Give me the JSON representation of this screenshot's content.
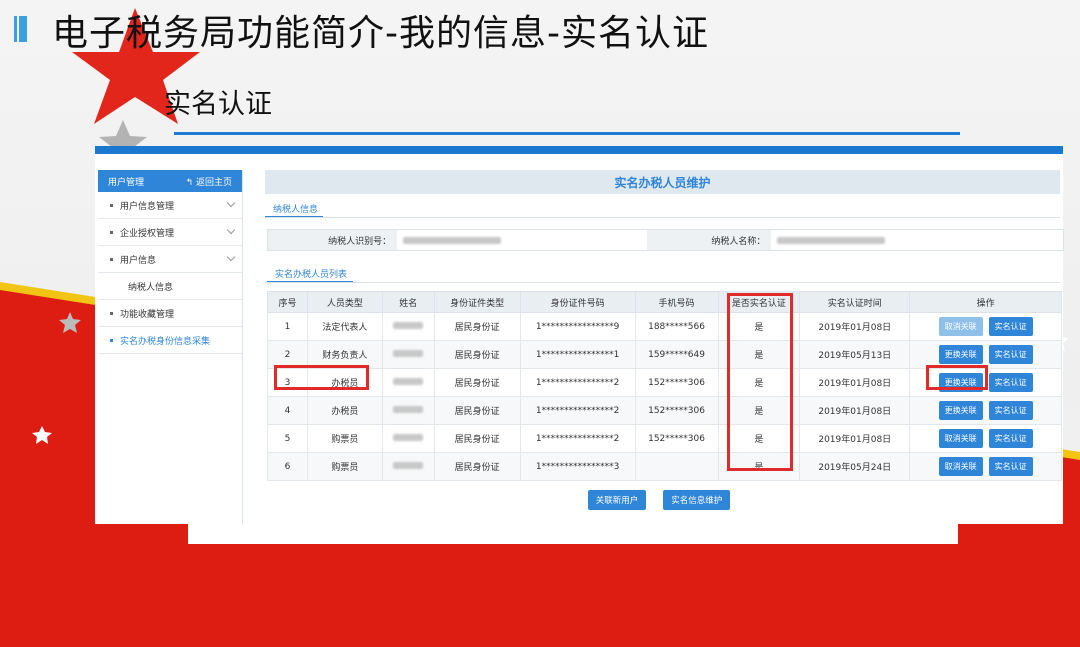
{
  "slide": {
    "title": "电子税务局功能简介-我的信息-实名认证",
    "subtitle": "实名认证"
  },
  "colors": {
    "accent": "#2f86d8",
    "highlight": "#e12a2a",
    "banner_red": "#dd1c12"
  },
  "sidebar": {
    "header": "用户管理",
    "back": "返回主页",
    "items": [
      {
        "label": "用户信息管理"
      },
      {
        "label": "企业授权管理"
      },
      {
        "label": "用户信息"
      },
      {
        "label": "纳税人信息"
      },
      {
        "label": "功能收藏管理"
      },
      {
        "label": "实名办税身份信息采集"
      }
    ]
  },
  "main": {
    "header": "实名办税人员维护",
    "tab1": "纳税人信息",
    "tab2": "实名办税人员列表",
    "taxpayer_id_label": "纳税人识别号：",
    "taxpayer_name_label": "纳税人名称："
  },
  "table": {
    "columns": [
      "序号",
      "人员类型",
      "姓名",
      "身份证件类型",
      "身份证件号码",
      "手机号码",
      "是否实名认证",
      "实名认证时间",
      "操作"
    ],
    "rows": [
      {
        "no": "1",
        "type": "法定代表人",
        "id_type": "居民身份证",
        "id_no": "1****************9",
        "phone": "188*****566",
        "verified": "是",
        "time": "2019年01月08日",
        "action": "取消关联",
        "auth": "实名认证"
      },
      {
        "no": "2",
        "type": "财务负责人",
        "id_type": "居民身份证",
        "id_no": "1****************1",
        "phone": "159*****649",
        "verified": "是",
        "time": "2019年05月13日",
        "action": "更换关联",
        "auth": "实名认证"
      },
      {
        "no": "3",
        "type": "办税员",
        "id_type": "居民身份证",
        "id_no": "1****************2",
        "phone": "152*****306",
        "verified": "是",
        "time": "2019年01月08日",
        "action": "更换关联",
        "auth": "实名认证"
      },
      {
        "no": "4",
        "type": "办税员",
        "id_type": "居民身份证",
        "id_no": "1****************2",
        "phone": "152*****306",
        "verified": "是",
        "time": "2019年01月08日",
        "action": "更换关联",
        "auth": "实名认证"
      },
      {
        "no": "5",
        "type": "购票员",
        "id_type": "居民身份证",
        "id_no": "1****************2",
        "phone": "152*****306",
        "verified": "是",
        "time": "2019年01月08日",
        "action": "取消关联",
        "auth": "实名认证"
      },
      {
        "no": "6",
        "type": "购票员",
        "id_type": "居民身份证",
        "id_no": "1****************3",
        "phone": "",
        "verified": "是",
        "time": "2019年05月24日",
        "action": "取消关联",
        "auth": "实名认证"
      }
    ]
  },
  "buttons": {
    "add_user": "关联新用户",
    "maintain": "实名信息维护"
  }
}
